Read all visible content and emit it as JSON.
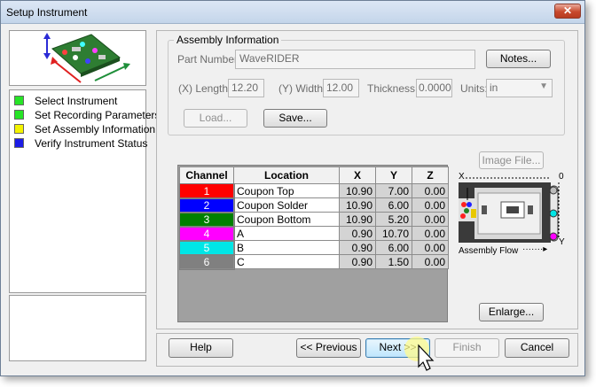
{
  "window": {
    "title": "Setup Instrument",
    "close_glyph": "✕"
  },
  "steps": [
    {
      "label": "Select Instrument",
      "color": "#27e427"
    },
    {
      "label": "Set Recording Parameters",
      "color": "#27e427"
    },
    {
      "label": "Set Assembly Information",
      "color": "#f3f300"
    },
    {
      "label": "Verify Instrument Status",
      "color": "#1c1ce6"
    }
  ],
  "assembly": {
    "group_title": "Assembly Information",
    "part_number_label": "Part Number:",
    "part_number_value": "WaveRIDER",
    "notes_button": "Notes...",
    "length_label": "(X) Length:",
    "length_value": "12.20",
    "width_label": "(Y) Width:",
    "width_value": "12.00",
    "thickness_label": "Thickness:",
    "thickness_value": "0.0000",
    "units_label": "Units:",
    "units_value": "in",
    "load_button": "Load...",
    "save_button": "Save..."
  },
  "image_file_button": "Image File...",
  "table": {
    "headers": [
      "Channel",
      "Location",
      "X",
      "Y",
      "Z"
    ],
    "rows": [
      {
        "channel": "1",
        "color": "#ff0000",
        "location": "Coupon Top",
        "x": "10.90",
        "y": "7.00",
        "z": "0.00"
      },
      {
        "channel": "2",
        "color": "#0000ff",
        "location": "Coupon Solder",
        "x": "10.90",
        "y": "6.00",
        "z": "0.00"
      },
      {
        "channel": "3",
        "color": "#008000",
        "location": "Coupon Bottom",
        "x": "10.90",
        "y": "5.20",
        "z": "0.00"
      },
      {
        "channel": "4",
        "color": "#ff00ff",
        "location": "A",
        "x": "0.90",
        "y": "10.70",
        "z": "0.00"
      },
      {
        "channel": "5",
        "color": "#00e6e6",
        "location": "B",
        "x": "0.90",
        "y": "6.00",
        "z": "0.00"
      },
      {
        "channel": "6",
        "color": "#808080",
        "location": "C",
        "x": "0.90",
        "y": "1.50",
        "z": "0.00"
      }
    ]
  },
  "diagram": {
    "x_label": "X",
    "zero_label": "0",
    "y_label": "Y",
    "flow_label": "Assembly Flow"
  },
  "enlarge_button": "Enlarge...",
  "footer": {
    "help": "Help",
    "previous": "<< Previous",
    "next": "Next >>",
    "finish": "Finish",
    "cancel": "Cancel"
  }
}
